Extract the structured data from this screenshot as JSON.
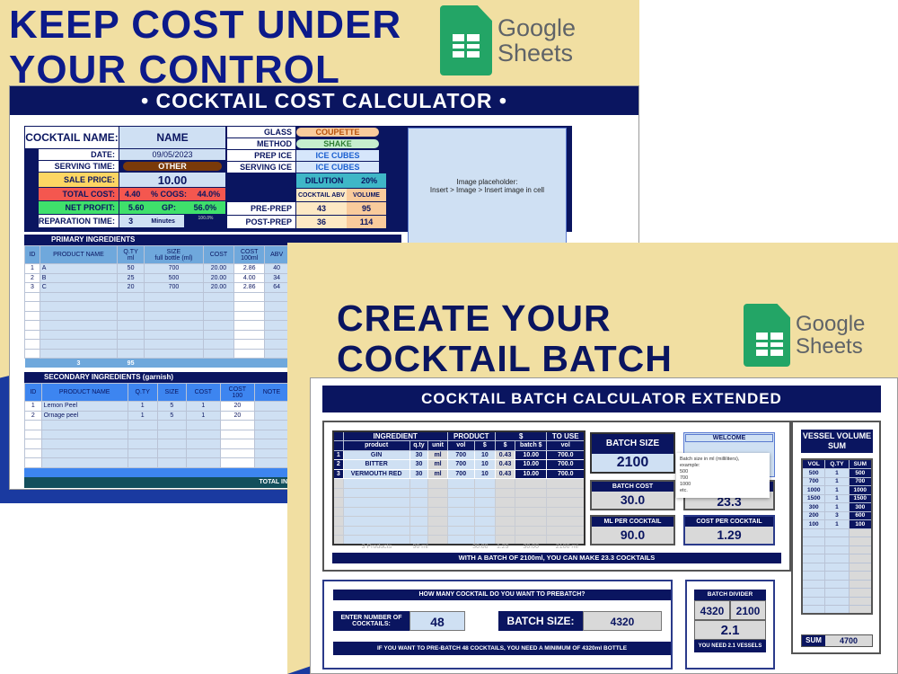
{
  "top": {
    "headline": [
      "KEEP COST UNDER",
      "YOUR CONTROL"
    ],
    "logo": {
      "line1": "Google",
      "line2": "Sheets"
    }
  },
  "cost": {
    "title": "• COCKTAIL COST CALCULATOR •",
    "name_label": "COCKTAIL NAME:",
    "name_value": "NAME",
    "date_label": "DATE:",
    "date_value": "09/05/2023",
    "serving_time_label": "SERVING TIME:",
    "serving_time_value": "OTHER",
    "sale_price_label": "SALE PRICE:",
    "sale_price_value": "10.00",
    "total_cost_label": "TOTAL COST:",
    "total_cost_value": "4.40",
    "cogs_label": "% COGS:",
    "cogs_value": "44.0%",
    "net_profit_label": "NET PROFIT:",
    "net_profit_value": "5.60",
    "gp_label": "GP:",
    "gp_value": "56.0%",
    "prep_time_label": "PREPARATION TIME:",
    "prep_time_value": "3",
    "prep_time_unit": "Minutes",
    "percent_small": "100.0%",
    "glass_label": "GLASS",
    "glass_value": "COUPETTE",
    "method_label": "METHOD",
    "method_value": "SHAKE",
    "prep_ice_label": "PREP ICE",
    "prep_ice_value": "ICE CUBES",
    "serving_ice_label": "SERVING ICE",
    "serving_ice_value": "ICE CUBES",
    "dilution_label": "DILUTION",
    "dilution_value": "20%",
    "abv_label": "COCKTAIL ABV",
    "volume_label": "VOLUME",
    "pre_prep_label": "PRE-PREP",
    "pre_abv": "43",
    "pre_vol": "95",
    "post_prep_label": "POST-PREP",
    "post_abv": "36",
    "post_vol": "114",
    "image_placeholder": "Image placeholder:",
    "image_hint": "Insert > Image > Insert image in cell",
    "primary": {
      "title": "PRIMARY INGREDIENTS",
      "headers": [
        "ID",
        "PRODUCT NAME",
        "Q.TY\nml",
        "SIZE\nfull bottle (ml)",
        "COST",
        "COST\n100ml",
        "ABV"
      ],
      "rows": [
        [
          "1",
          "A",
          "50",
          "700",
          "20.00",
          "2.86",
          "40"
        ],
        [
          "2",
          "B",
          "25",
          "500",
          "20.00",
          "4.00",
          "34"
        ],
        [
          "3",
          "C",
          "20",
          "700",
          "20.00",
          "2.86",
          "64"
        ]
      ],
      "footer_count": "3",
      "footer_qty": "95"
    },
    "secondary": {
      "title": "SECONDARY INGREDIENTS (garnish)",
      "headers": [
        "ID",
        "PRODUCT NAME",
        "Q.TY",
        "SIZE",
        "COST",
        "COST\n100",
        "NOTE"
      ],
      "rows": [
        [
          "1",
          "Lemon Peel",
          "1",
          "5",
          "1",
          "20",
          ""
        ],
        [
          "2",
          "Ornage peel",
          "1",
          "5",
          "1",
          "20",
          ""
        ]
      ],
      "total_label": "TOTAL IN"
    }
  },
  "batch": {
    "headline": [
      "CREATE YOUR",
      "COCKTAIL BATCH"
    ],
    "title": "COCKTAIL BATCH CALCULATOR EXTENDED",
    "group_headers": [
      "INGREDIENT",
      "PRODUCT",
      "$",
      "TO USE"
    ],
    "headers": [
      "product",
      "q.ty",
      "unit",
      "vol",
      "$",
      "$",
      "batch $",
      "vol"
    ],
    "rows": [
      [
        "1",
        "GIN",
        "30",
        "ml",
        "700",
        "10",
        "0.43",
        "10.00",
        "700.0"
      ],
      [
        "2",
        "BITTER",
        "30",
        "ml",
        "700",
        "10",
        "0.43",
        "10.00",
        "700.0"
      ],
      [
        "3",
        "VERMOUTH RED",
        "30",
        "ml",
        "700",
        "10",
        "0.43",
        "10.00",
        "700.0"
      ]
    ],
    "totals": [
      "3 Products",
      "90 ml",
      "",
      "",
      "30.00",
      "1.29",
      "30.00",
      "2100 ml"
    ],
    "summary": "WITH A BATCH OF 2100ml, YOU CAN MAKE 23.3 COCKTAILS",
    "batch_size_label": "BATCH SIZE",
    "batch_size_value": "2100",
    "welcome_label": "WELCOME",
    "tooltip": [
      "Batch size in ml (milliliters),",
      "example:",
      "500",
      "700",
      "1000",
      "etc."
    ],
    "batch_cost_label": "BATCH COST",
    "batch_cost_value": "30.0",
    "hidden_value": "23.3",
    "ml_per_label": "ML PER COCKTAIL",
    "ml_per_value": "90.0",
    "cost_per_label": "COST PER COCKTAIL",
    "cost_per_value": "1.29",
    "prebatch_q": "HOW MANY COCKTAIL DO YOU WANT TO PREBATCH?",
    "enter_label": "ENTER NUMBER OF COCKTAILS:",
    "enter_value": "48",
    "batch_size2_label": "BATCH SIZE:",
    "batch_size2_value": "4320",
    "prebatch_msg": "IF YOU WANT TO PRE-BATCH 48 COCKTAILS, YOU NEED A MINIMUM OF 4320ml BOTTLE",
    "divider_label": "BATCH DIVIDER",
    "divider_a": "4320",
    "divider_b": "2100",
    "divider_result": "2.1",
    "divider_msg": "YOU NEED 2.1 VESSELS",
    "vessel_title": "VESSEL VOLUME SUM",
    "vessel_headers": [
      "VOL",
      "Q.TY",
      "SUM"
    ],
    "vessels": [
      [
        "500",
        "1",
        "500"
      ],
      [
        "700",
        "1",
        "700"
      ],
      [
        "1000",
        "1",
        "1000"
      ],
      [
        "1500",
        "1",
        "1500"
      ],
      [
        "300",
        "1",
        "300"
      ],
      [
        "200",
        "3",
        "600"
      ],
      [
        "100",
        "1",
        "100"
      ]
    ],
    "sum_label": "SUM",
    "sum_value": "4700"
  },
  "colors": {
    "navy": "#0a1560",
    "red": "#f4574f",
    "green": "#3fe06b",
    "yellow": "#fdd663",
    "teal": "#3fb7c7",
    "peach": "#f9cb9c",
    "brown": "#7a3a0a",
    "beige": "#f1dfa2"
  }
}
